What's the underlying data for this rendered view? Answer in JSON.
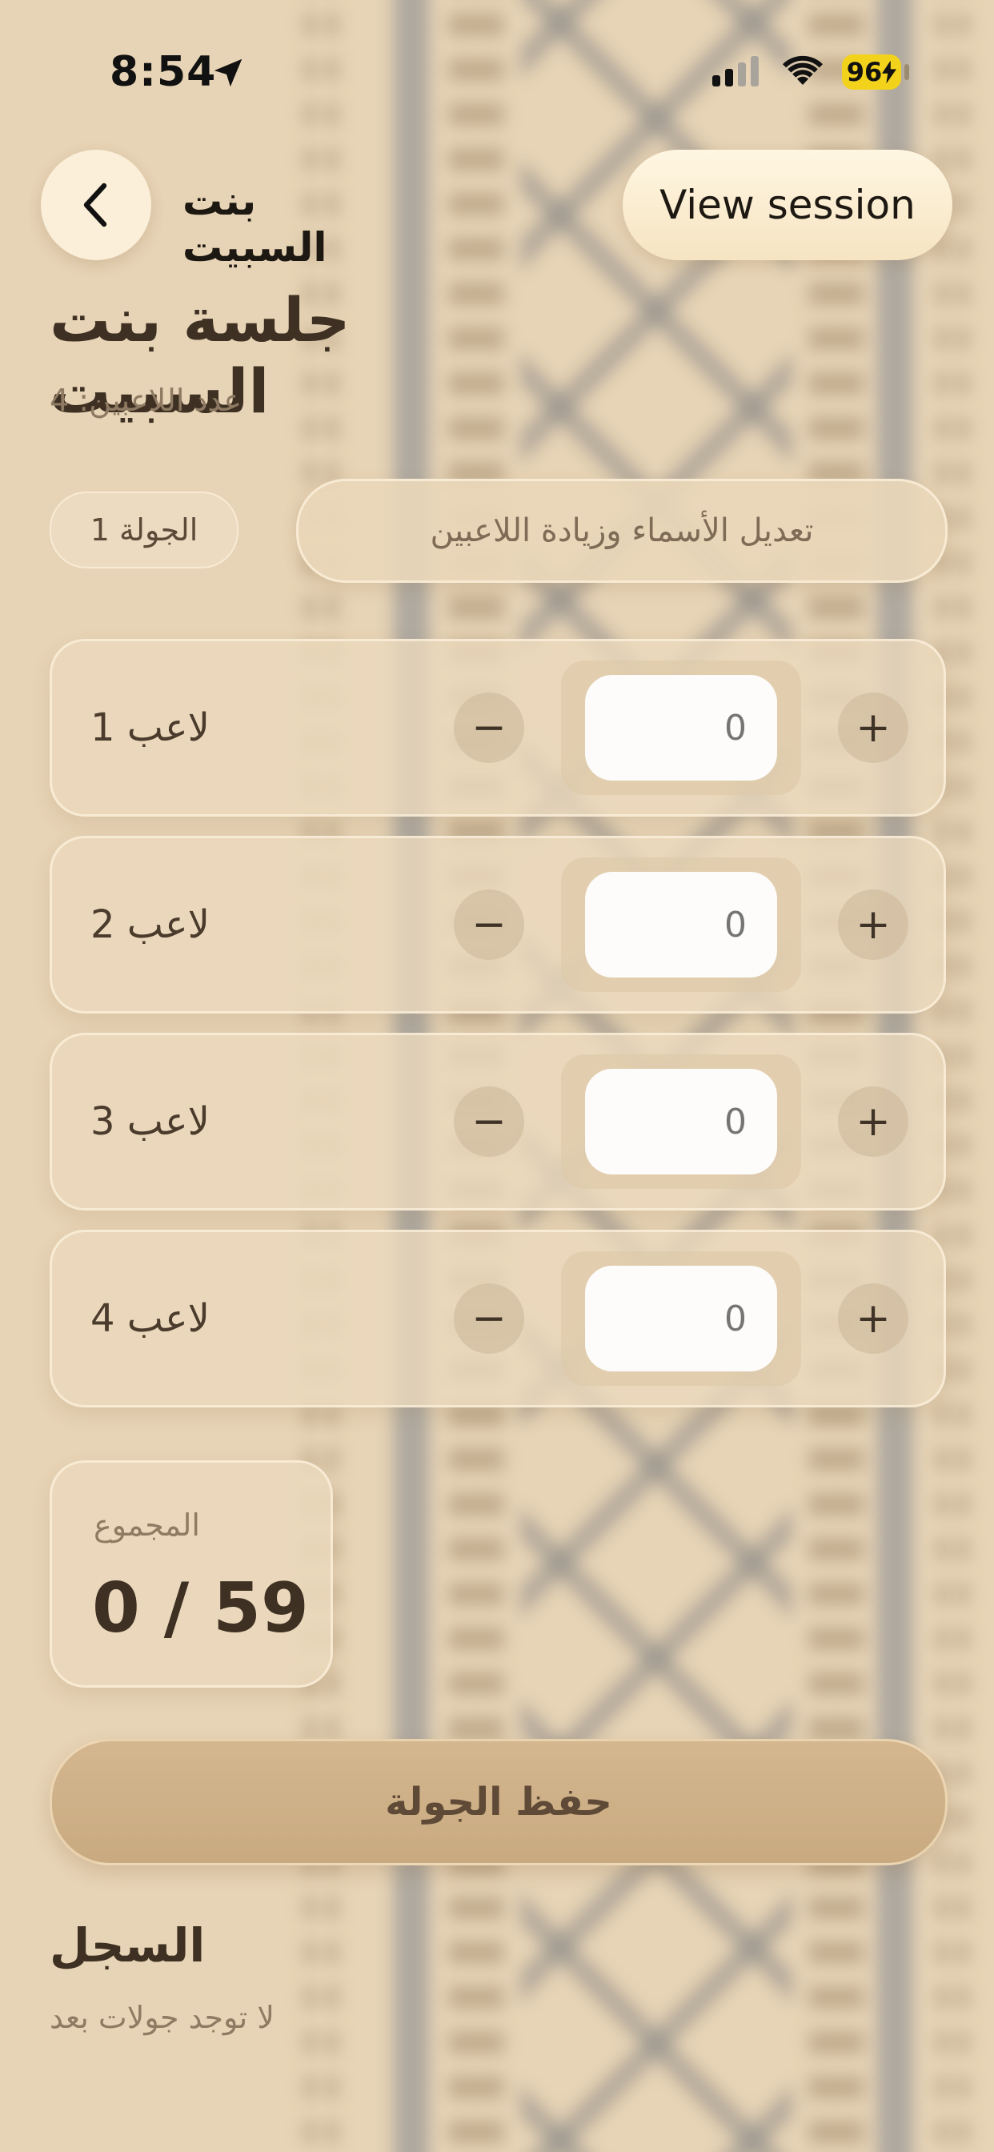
{
  "status_bar": {
    "time": "8:54",
    "battery": "96"
  },
  "nav": {
    "title": "بنت السبيت",
    "view_session": "View session"
  },
  "header": {
    "title": "جلسة بنت السبيت",
    "players_count": "عدد اللاعبين: 4"
  },
  "controls": {
    "round_label": "الجولة 1",
    "edit_players": "تعديل الأسماء وزيادة اللاعبين"
  },
  "players": [
    {
      "name": "لاعب 1",
      "score_placeholder": "0"
    },
    {
      "name": "لاعب 2",
      "score_placeholder": "0"
    },
    {
      "name": "لاعب 3",
      "score_placeholder": "0"
    },
    {
      "name": "لاعب 4",
      "score_placeholder": "0"
    }
  ],
  "stepper": {
    "minus": "−",
    "plus": "+"
  },
  "total": {
    "label": "المجموع",
    "value": "0 / 59"
  },
  "save_round": "حفظ الجولة",
  "history": {
    "title": "السجل",
    "empty": "لا توجد جولات بعد"
  },
  "colors": {
    "background": "#e6d2b3",
    "accent": "#c9aa80",
    "text": "#3e3022",
    "battery": "#f3d21c"
  }
}
